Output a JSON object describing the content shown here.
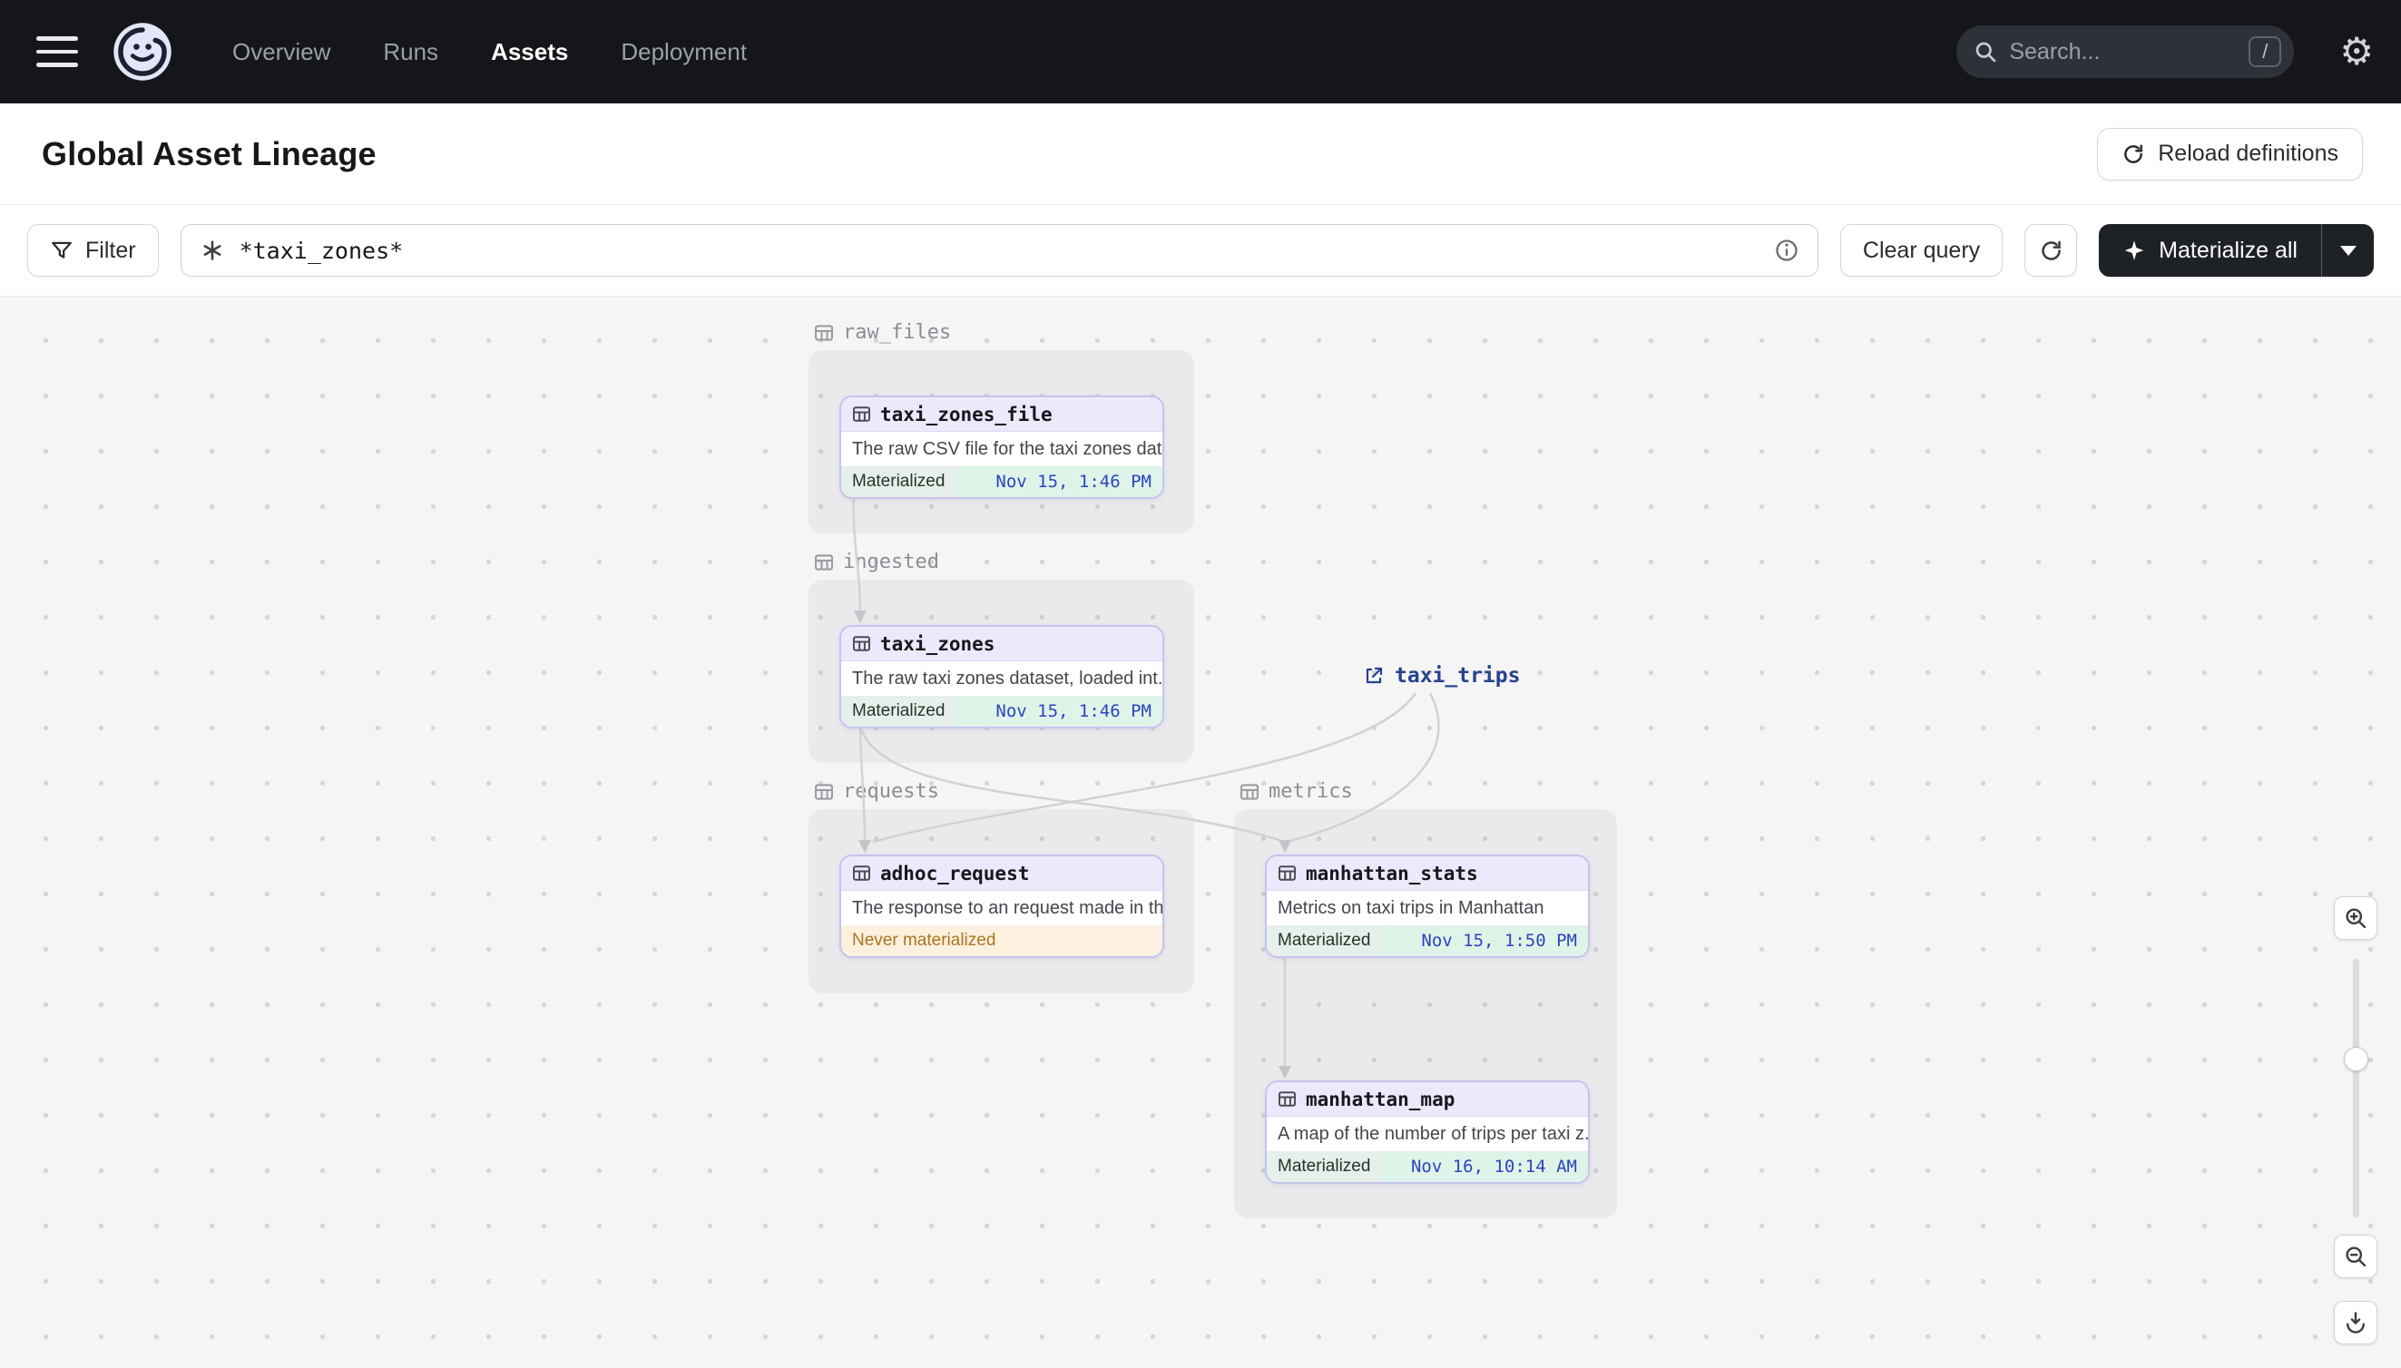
{
  "navbar": {
    "brand": "Dagster",
    "items": [
      {
        "label": "Overview",
        "active": false
      },
      {
        "label": "Runs",
        "active": false
      },
      {
        "label": "Assets",
        "active": true
      },
      {
        "label": "Deployment",
        "active": false
      }
    ],
    "search": {
      "placeholder": "Search...",
      "shortcut_key": "/"
    }
  },
  "header": {
    "title": "Global Asset Lineage",
    "reload_button_label": "Reload definitions"
  },
  "toolbar": {
    "filter_label": "Filter",
    "query_value": "*taxi_zones*",
    "clear_query_label": "Clear query",
    "materialize_all_label": "Materialize all"
  },
  "graph": {
    "groups": [
      {
        "name": "raw_files"
      },
      {
        "name": "ingested"
      },
      {
        "name": "requests"
      },
      {
        "name": "metrics"
      }
    ],
    "nodes": [
      {
        "name": "taxi_zones_file",
        "group": "raw_files",
        "description": "The raw CSV file for the taxi zones dat...",
        "status": "Materialized",
        "timestamp": "Nov 15, 1:46 PM"
      },
      {
        "name": "taxi_zones",
        "group": "ingested",
        "description": "The raw taxi zones dataset, loaded int...",
        "status": "Materialized",
        "timestamp": "Nov 15, 1:46 PM"
      },
      {
        "name": "adhoc_request",
        "group": "requests",
        "description": "The response to an request made in th...",
        "status": "Never materialized",
        "timestamp": ""
      },
      {
        "name": "manhattan_stats",
        "group": "metrics",
        "description": "Metrics on taxi trips in Manhattan",
        "status": "Materialized",
        "timestamp": "Nov 15, 1:50 PM"
      },
      {
        "name": "manhattan_map",
        "group": "metrics",
        "description": "A map of the number of trips per taxi z...",
        "status": "Materialized",
        "timestamp": "Nov 16, 10:14 AM"
      }
    ],
    "external_nodes": [
      {
        "name": "taxi_trips"
      }
    ],
    "edges": [
      {
        "from": "taxi_zones_file",
        "to": "taxi_zones"
      },
      {
        "from": "taxi_zones",
        "to": "adhoc_request"
      },
      {
        "from": "taxi_zones",
        "to": "manhattan_stats"
      },
      {
        "from": "taxi_trips",
        "to": "adhoc_request"
      },
      {
        "from": "taxi_trips",
        "to": "manhattan_stats"
      },
      {
        "from": "manhattan_stats",
        "to": "manhattan_map"
      }
    ]
  },
  "canvas_controls": {
    "slider_value_pct": 38
  },
  "icons": {
    "menu": "hamburger",
    "search": "magnifier",
    "settings": "gear",
    "reload": "circular-arrow",
    "filter": "funnel",
    "query_selector": "asterisk",
    "query_info": "info-circle",
    "refresh": "circular-arrow",
    "materialize": "sparkle",
    "asset": "table-grid",
    "external": "external-link",
    "zoom_in": "magnifier-plus",
    "zoom_out": "magnifier-minus",
    "download": "arrow-down-tray"
  },
  "colors": {
    "navbar_bg": "#14161a",
    "node_border": "#c6c3ef",
    "node_header_bg": "#ebe9fb",
    "materialized_bg": "#dff4e8",
    "timestamp_text": "#2b44bf",
    "never_materialized_bg": "#fbf1de",
    "never_materialized_text": "#ad7421",
    "external_link_text": "#26418f",
    "edge": "#d2d2d6"
  }
}
